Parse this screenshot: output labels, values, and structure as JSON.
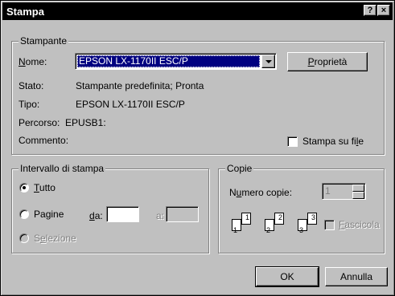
{
  "window": {
    "title": "Stampa",
    "help_label": "?",
    "close_label": "×"
  },
  "printer": {
    "group_label": "Stampante",
    "name_label": "Nome:",
    "name_value": "EPSON LX-1170II ESC/P",
    "properties_label": "Proprietà",
    "status_label": "Stato:",
    "status_value": "Stampante predefinita; Pronta",
    "type_label": "Tipo:",
    "type_value": "EPSON LX-1170II ESC/P",
    "path_label": "Percorso:",
    "path_value": "EPUSB1:",
    "comment_label": "Commento:",
    "print_to_file_label": "Stampa su file"
  },
  "range": {
    "group_label": "Intervallo di stampa",
    "all_label": "Tutto",
    "pages_label": "Pagine",
    "from_label": "da:",
    "to_label": "a:",
    "selection_label": "Selezione"
  },
  "copies": {
    "group_label": "Copie",
    "count_label": "Numero copie:",
    "count_value": "1",
    "collate_label": "Fascicola",
    "page_icons": [
      "1",
      "1",
      "2",
      "2",
      "3",
      "3"
    ]
  },
  "buttons": {
    "ok_label": "OK",
    "cancel_label": "Annulla"
  }
}
